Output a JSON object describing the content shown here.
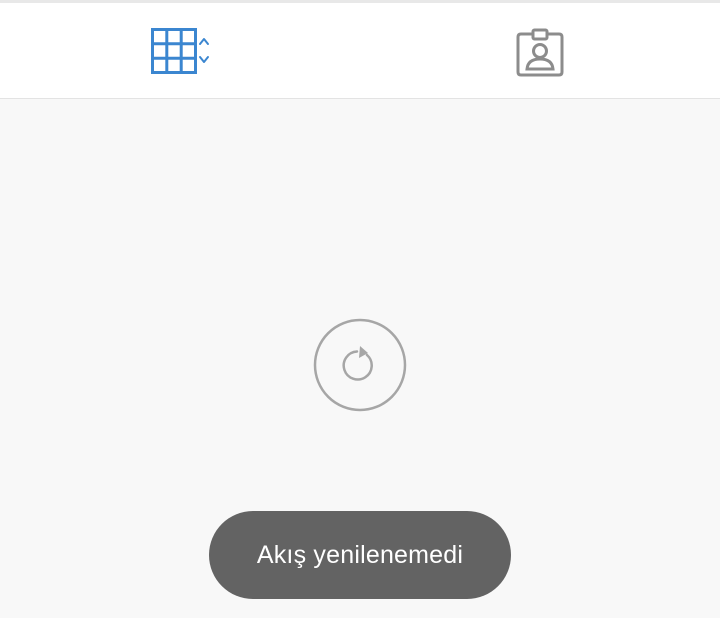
{
  "tabs": [
    {
      "id": "grid-view",
      "icon": "grid-sort-icon",
      "active": true,
      "color": "#3b86d0"
    },
    {
      "id": "profile",
      "icon": "profile-badge-icon",
      "active": false,
      "color": "#8c8c8c"
    }
  ],
  "reload": {
    "icon": "refresh-icon",
    "color": "#a6a6a6"
  },
  "toast": {
    "message": "Akış yenilenemedi",
    "background": "#636363"
  }
}
